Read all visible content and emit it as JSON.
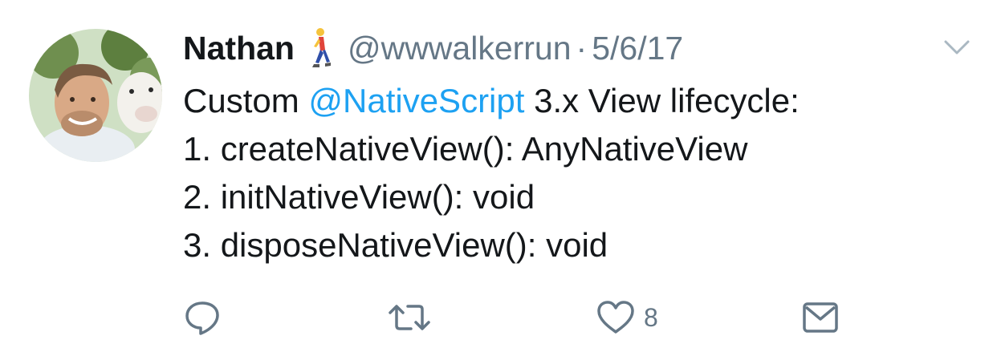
{
  "user": {
    "display_name": "Nathan",
    "emoji": "person-walking",
    "handle": "@wwwalkerrun",
    "separator": "·",
    "date": "5/6/17"
  },
  "tweet": {
    "prefix": "Custom ",
    "mention": "@NativeScript",
    "suffix": " 3.x View lifecycle:",
    "lines": [
      "1. createNativeView(): AnyNativeView",
      "2. initNativeView(): void",
      "3. disposeNativeView(): void"
    ]
  },
  "actions": {
    "reply_icon": "reply-icon",
    "retweet_icon": "retweet-icon",
    "like_icon": "heart-icon",
    "like_count": "8",
    "message_icon": "envelope-icon"
  },
  "colors": {
    "text": "#14171a",
    "secondary": "#657786",
    "link": "#1da1f2",
    "icon": "#657786"
  }
}
